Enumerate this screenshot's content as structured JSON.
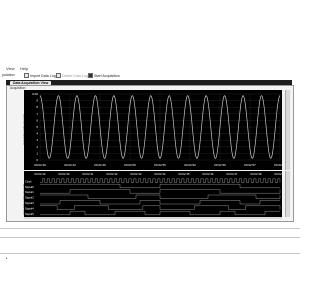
{
  "menu": {
    "items": [
      "View",
      "Help"
    ]
  },
  "toolbar": {
    "item_1": "pulation",
    "item_2": "Import Data Log",
    "item_3": "Delete Data Log",
    "item_4": "Start Acquisition"
  },
  "tab": {
    "label": "Data Acquisition View"
  },
  "panel_label": "Acquisition",
  "analog": {
    "ylabel": "Acquisition Channel 1A",
    "y_ticks": [
      "0.00",
      "9",
      "8",
      "7",
      "6",
      "5",
      "4",
      "3",
      "2",
      "1",
      "0"
    ],
    "x_ticks": [
      "00:02:39",
      "00:02:42",
      "00:02:46",
      "00:02:50",
      "00:02:55",
      "00:02:52",
      "00:02:56",
      "00:02:57",
      "00:02:58"
    ],
    "cycles": 13,
    "colors": {
      "bg": "#000000",
      "trace": "#c8c8c8",
      "grid": "#3a3a3a",
      "tick": "#ffffff"
    }
  },
  "digital": {
    "ylabel": "Acquisition Channel 10",
    "x_ticks": [
      "00:02:29",
      "00:02:30",
      "00:02:31",
      "00:02:32",
      "00:02:33",
      "00:02:34",
      "00:02:35",
      "00:02:36",
      "00:02:37",
      "00:02:38",
      "00:02:39"
    ],
    "channels": [
      {
        "name": "Clock"
      },
      {
        "name": "Signal0"
      },
      {
        "name": "Signal1"
      },
      {
        "name": "Signal2"
      },
      {
        "name": "Signal3"
      },
      {
        "name": "Signal4"
      },
      {
        "name": "Signal5"
      }
    ],
    "colors": {
      "bg": "#000000",
      "trace": "#d0d0d0",
      "tick": "#ffffff"
    }
  }
}
